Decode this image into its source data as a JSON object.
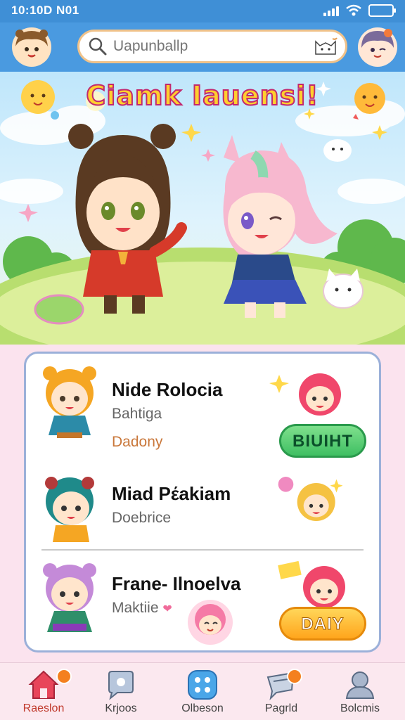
{
  "status_bar": {
    "time": "10:10D N01"
  },
  "header": {
    "search_placeholder": "Uapunballp"
  },
  "hero": {
    "title": "Ciamk Iauensi!"
  },
  "list": [
    {
      "title": "Nide Rolocia",
      "subtitle": "Bahtiga",
      "extra": "Dadony",
      "button": "BIUIHT",
      "button_color": "#3fbf63"
    },
    {
      "title": "Miad Pέakiam",
      "subtitle": "Doebrice"
    },
    {
      "title": "Frane- Ilnoelva",
      "subtitle": "Maktiie",
      "button": "DAIY",
      "button_color": "#ffa51c"
    }
  ],
  "bottom_nav": [
    {
      "label": "Raeslon",
      "icon": "home-icon",
      "active": true,
      "badge": true
    },
    {
      "label": "Krjoos",
      "icon": "chat-bubble-icon",
      "active": false,
      "badge": false
    },
    {
      "label": "Olbeson",
      "icon": "grid-icon",
      "active": false,
      "badge": false
    },
    {
      "label": "Pagrld",
      "icon": "message-icon",
      "active": false,
      "badge": true
    },
    {
      "label": "Bolcmis",
      "icon": "profile-icon",
      "active": false,
      "badge": false
    }
  ],
  "colors": {
    "header": "#4a9ae0",
    "status_bar": "#3f8fd6",
    "accent_pink": "#f06b9a",
    "active_nav": "#c0392b"
  }
}
